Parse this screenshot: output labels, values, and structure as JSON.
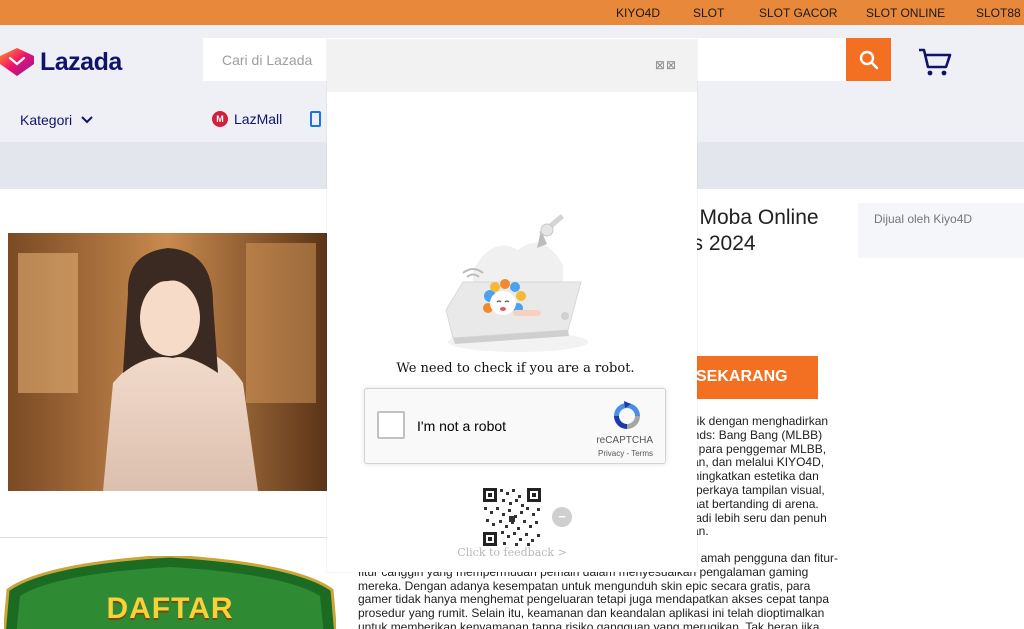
{
  "topbar": {
    "links": [
      "KIYO4D",
      "SLOT",
      "SLOT GACOR",
      "SLOT ONLINE",
      "SLOT88"
    ],
    "color": "#e8883a"
  },
  "header": {
    "logo_text": "Lazada",
    "search_placeholder": "Cari di Lazada",
    "kategori_label": "Kategori",
    "lazmall_label": "LazMall",
    "icons": [
      "search-icon",
      "cart-icon",
      "chevron-down-icon",
      "lazmall-icon",
      "phone-icon"
    ],
    "accent": "#f36f21"
  },
  "product": {
    "title_line1": "e Moba Online",
    "title_line2": "tis 2024",
    "seller": "Dijual oleh Kiyo4D",
    "cta_label": "SEKARANG",
    "para1_lines": [
      "arik dengan menghadirkan",
      "ends: Bang Bang (MLBB)",
      "gi para penggemar MLBB,",
      "kan, dan melalui KIYO4D,",
      "eningkatkan estetika dan",
      "mperkaya tampilan visual,",
      "saat bertanding di arena.",
      "njadi lebih seru dan penuh",
      "kan."
    ],
    "para2_lines": [
      "amah pengguna dan fitur-",
      "fitur canggih yang mempermudah pemain dalam menyesuaikan pengalaman gaming",
      "mereka. Dengan adanya kesempatan untuk mengunduh skin epic secara gratis, para",
      "gamer tidak hanya menghemat pengeluaran tetapi juga mendapatkan akses cepat tanpa",
      "prosedur yang rumit. Selain itu, keamanan dan keandalan aplikasi ini telah dioptimalkan",
      "untuk memberikan kenyamanan tanpa risiko gangguan yang merugikan. Tak heran jika"
    ],
    "banner_text": "DAFTAR"
  },
  "captcha": {
    "close_glyph": "⊠⊠",
    "message": "We need to check if you are a robot.",
    "checkbox_label": "I'm not a robot",
    "brand": "reCAPTCHA",
    "privacy": "Privacy",
    "separator": " - ",
    "terms": "Terms",
    "minus_glyph": "−",
    "feedback": "Click to feedback >"
  }
}
